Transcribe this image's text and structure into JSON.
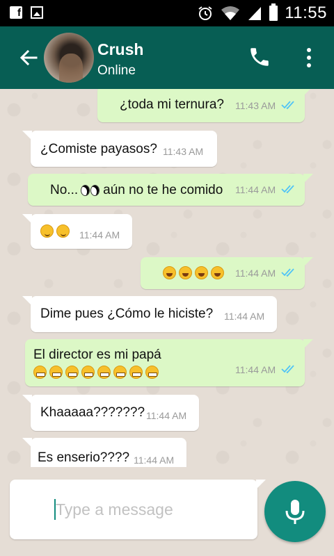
{
  "status_bar": {
    "time": "11:55"
  },
  "header": {
    "name": "Crush",
    "status": "Online"
  },
  "messages": [
    {
      "dir": "out",
      "text": "¿toda mi ternura?",
      "time": "11:43 AM",
      "read": true
    },
    {
      "dir": "in",
      "text": "¿Comiste payasos?",
      "time": "11:43 AM"
    },
    {
      "dir": "out",
      "text_before": "No...",
      "emoji": "eyes",
      "text_after": "aún no te he comido",
      "time": "11:44 AM",
      "read": true
    },
    {
      "dir": "in",
      "emoji": "smirking-face x2",
      "time": "11:44 AM"
    },
    {
      "dir": "out",
      "emoji": "face-with-tears-of-joy x4",
      "time": "11:44 AM",
      "read": true
    },
    {
      "dir": "in",
      "text": "Dime pues ¿Cómo le hiciste?",
      "time": "11:44 AM"
    },
    {
      "dir": "out",
      "text": "El director es mi papá",
      "emoji": "grimacing-face x8",
      "time": "11:44 AM",
      "read": true
    },
    {
      "dir": "in",
      "text": "Khaaaaa???????",
      "time": "11:44 AM"
    },
    {
      "dir": "in",
      "text": "Es enserio????",
      "time": "11:44 AM"
    }
  ],
  "composer": {
    "placeholder": "Type a message"
  },
  "colors": {
    "header": "#075e54",
    "outgoing_bubble": "#dcf8c6",
    "incoming_bubble": "#ffffff",
    "chat_background": "#e5ddd5",
    "read_ticks": "#4fc3f7",
    "mic_button": "#128c7e"
  },
  "icons": [
    "facebook-icon",
    "image-icon",
    "alarm-icon",
    "wifi-icon",
    "signal-icon",
    "battery-icon",
    "back-arrow-icon",
    "phone-icon",
    "more-vert-icon",
    "double-check-icon",
    "mic-icon"
  ]
}
